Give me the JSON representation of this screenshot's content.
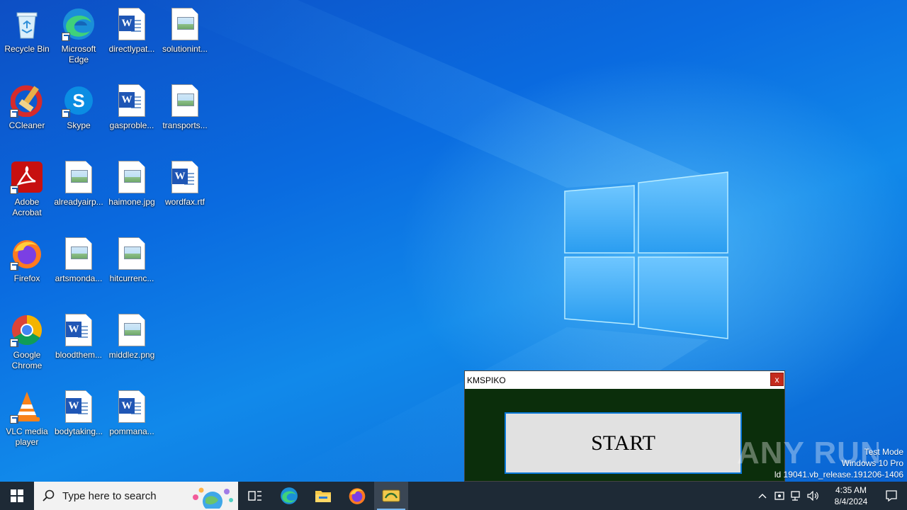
{
  "desktop": {
    "icons": [
      {
        "label": "Recycle Bin"
      },
      {
        "label": "Microsoft Edge"
      },
      {
        "label": "directlypat..."
      },
      {
        "label": "solutionint..."
      },
      {
        "label": "CCleaner"
      },
      {
        "label": "Skype"
      },
      {
        "label": "gasproble..."
      },
      {
        "label": "transports..."
      },
      {
        "label": "Adobe Acrobat"
      },
      {
        "label": "alreadyairp..."
      },
      {
        "label": "haimone.jpg"
      },
      {
        "label": "wordfax.rtf"
      },
      {
        "label": "Firefox"
      },
      {
        "label": "artsmonda..."
      },
      {
        "label": "hitcurrenc..."
      },
      {
        "label": "Google Chrome"
      },
      {
        "label": "bloodthem..."
      },
      {
        "label": "middlez.png"
      },
      {
        "label": "VLC media player"
      },
      {
        "label": "bodytaking..."
      },
      {
        "label": "pommana..."
      }
    ]
  },
  "kms_window": {
    "title": "KMSPIKO",
    "close_label": "x",
    "start_label": "START"
  },
  "watermark": {
    "text": "ANY RUN"
  },
  "system_info": {
    "line1": "Test Mode",
    "line2": "Windows 10 Pro",
    "line3": "ld 19041.vb_release.191206-1406"
  },
  "taskbar": {
    "search_placeholder": "Type here to search",
    "clock_time": "4:35 AM",
    "clock_date": "8/4/2024"
  },
  "colors": {
    "kms_body": "#0b2e0b",
    "kms_button": "#e1e1e1",
    "kms_button_border": "#0a78d7",
    "taskbar": "#1e2a36",
    "close_red": "#c42b1c"
  }
}
